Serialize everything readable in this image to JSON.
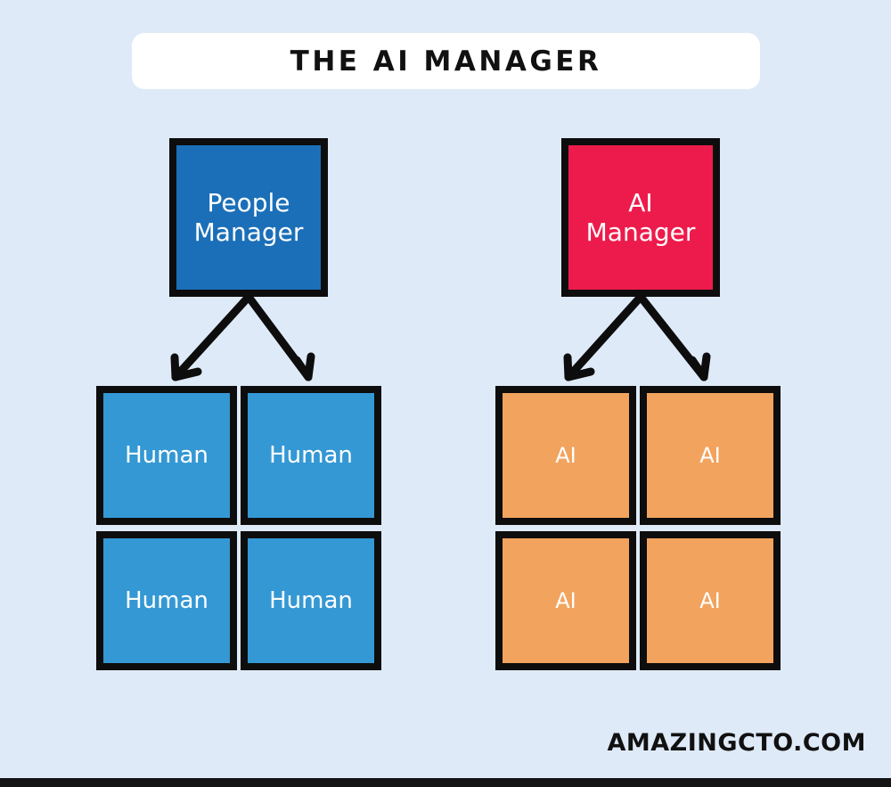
{
  "title": {
    "text": "THE AI MANAGER"
  },
  "colors": {
    "background": "#dfeaf8",
    "title_card": "#ffffff",
    "people_manager": "#1b6fb8",
    "ai_manager": "#ed1b4b",
    "human": "#3498d4",
    "ai": "#f2a35e",
    "outline": "#0d0d0d",
    "text_on_node": "#ffffff",
    "bottom_bar": "#141414"
  },
  "diagram": {
    "type": "org-chart",
    "branches": [
      {
        "id": "people",
        "manager": {
          "label": "People\nManager"
        },
        "children": [
          {
            "label": "Human"
          },
          {
            "label": "Human"
          },
          {
            "label": "Human"
          },
          {
            "label": "Human"
          }
        ]
      },
      {
        "id": "ai",
        "manager": {
          "label": "AI\nManager"
        },
        "children": [
          {
            "label": "AI"
          },
          {
            "label": "AI"
          },
          {
            "label": "AI"
          },
          {
            "label": "AI"
          }
        ]
      }
    ],
    "connectors": {
      "style": "hand-drawn-arrow",
      "count": 4,
      "description": "two arrows from each manager box down to the two boxes of its top child row"
    }
  },
  "footer": {
    "text": "AMAZINGCTO.COM"
  }
}
